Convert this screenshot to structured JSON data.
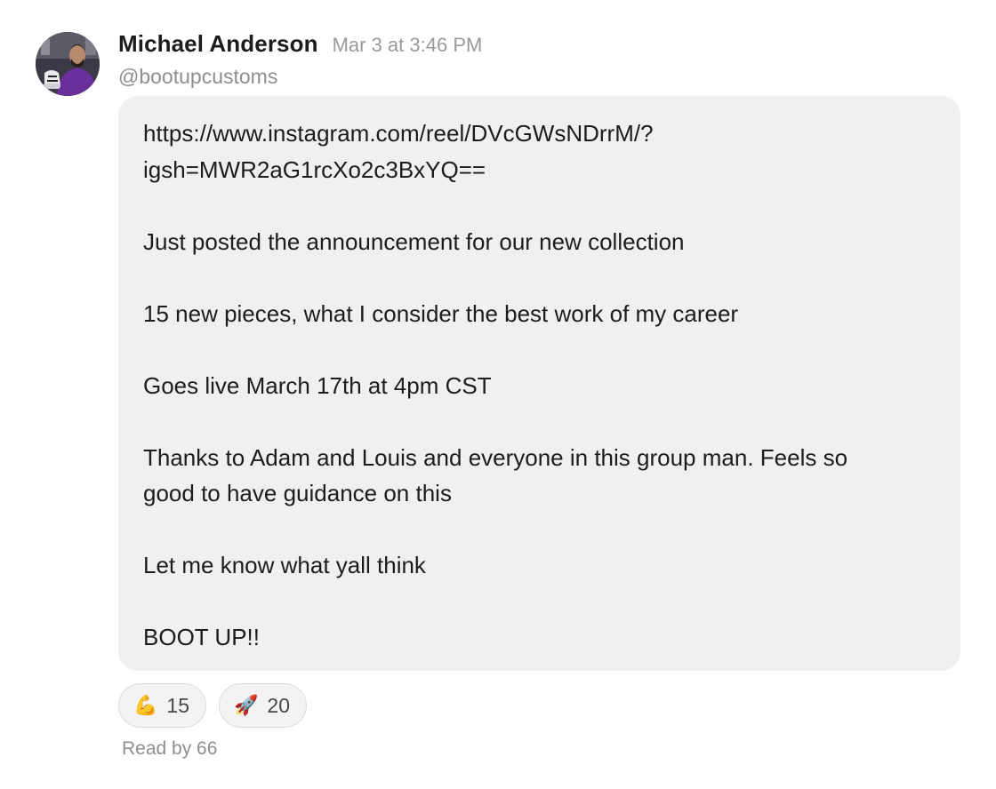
{
  "message": {
    "sender_name": "Michael Anderson",
    "timestamp": "Mar 3 at 3:46 PM",
    "handle": "@bootupcustoms",
    "avatar": "profile-photo",
    "body_lines": [
      "https://www.instagram.com/reel/DVcGWsNDrrM/?",
      "igsh=MWR2aG1rcXo2c3BxYQ==",
      "",
      "Just posted the announcement for our new collection",
      "",
      "15 new pieces, what I consider the best work of my career",
      "",
      "Goes live March 17th at 4pm CST",
      "",
      "Thanks to Adam and Louis and everyone in this group man. Feels so",
      "good to have guidance on this",
      "",
      "Let me know what yall think",
      "",
      "BOOT UP!!"
    ],
    "bubble_color": "#f0f0f1"
  },
  "reactions": [
    {
      "emoji": "💪",
      "icon": "flexed-biceps-icon",
      "count": "15"
    },
    {
      "emoji": "🚀",
      "icon": "rocket-icon",
      "count": "20"
    }
  ],
  "read_receipt": "Read by 66"
}
